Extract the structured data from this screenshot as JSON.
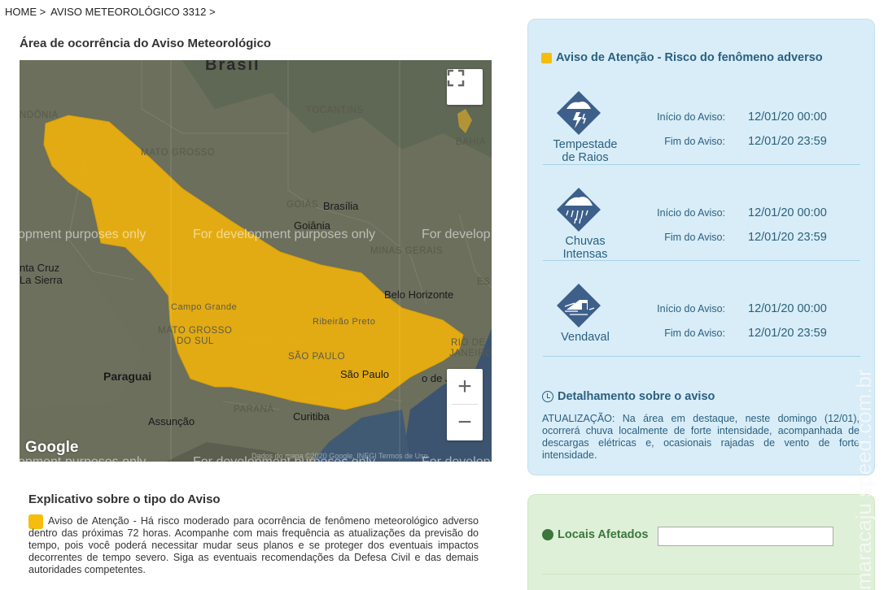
{
  "breadcrumb": {
    "home": "HOME >",
    "current": "AVISO METEOROLÓGICO 3312 >"
  },
  "map": {
    "title": "Área de ocorrência do Aviso Meteorológico",
    "country_label": "Brasil",
    "dev_watermark": "For development purposes only",
    "dev_watermark_left": "opment purposes only",
    "dev_watermark_right": "For develop",
    "labels": {
      "rondonia": "NDÔNIA",
      "tocantins": "TOCANTINS",
      "bahia": "BAHIA",
      "mato_grosso": "MATO GROSSO",
      "goias": "GOIÁS",
      "brasilia": "Brasília",
      "goiania": "Goiânia",
      "minas": "MINAS GERAIS",
      "es": "ES",
      "santa_cruz": "nta Cruz",
      "la_sierra": "La Sierra",
      "belo_horizonte": "Belo Horizonte",
      "campo_grande": "Campo Grande",
      "ms1": "MATO GROSSO",
      "ms2": "DO SUL",
      "ribeirao": "Ribeirão Preto",
      "rio1": "RIO DE",
      "rio2": "JANEIRO",
      "sao_paulo_state": "SÃO PAULO",
      "sao_paulo": "São Paulo",
      "rio_city": "o de Ja",
      "paraguai": "Paraguai",
      "parana": "PARANÁ",
      "curitiba": "Curitiba",
      "assuncao": "Assunção"
    },
    "google": "Google",
    "copyright": "Dados do mapa ©2020 Google, INEGI    Termos de Uso",
    "zoom_in": "+",
    "zoom_out": "−",
    "fullscreen_icon": "fullscreen-icon",
    "alert_color": "#f6bd0d"
  },
  "explicativo": {
    "title": "Explicativo sobre o tipo do Aviso",
    "text": "Aviso de Atenção - Há risco moderado para ocorrência de fenômeno meteorológico adverso dentro das próximas 72 horas. Acompanhe com mais frequência as atualizações da previsão do tempo, pois você poderá necessitar mudar seus planos e se proteger dos eventuais impactos decorrentes de tempo severo. Siga as eventuais recomendações da Defesa Civil e das demais autoridades competentes."
  },
  "aviso": {
    "title": "Aviso de Atenção - Risco do fenômeno adverso",
    "events": [
      {
        "name_line1": "Tempestade",
        "name_line2": "de Raios",
        "icon": "lightning-storm-icon",
        "inicio_label": "Início do Aviso:",
        "inicio": "12/01/20 00:00",
        "fim_label": "Fim do Aviso:",
        "fim": "12/01/20 23:59"
      },
      {
        "name_line1": "Chuvas",
        "name_line2": "Intensas",
        "icon": "heavy-rain-icon",
        "inicio_label": "Início do Aviso:",
        "inicio": "12/01/20 00:00",
        "fim_label": "Fim do Aviso:",
        "fim": "12/01/20 23:59"
      },
      {
        "name_line1": "Vendaval",
        "name_line2": "",
        "icon": "windstorm-icon",
        "inicio_label": "Início do Aviso:",
        "inicio": "12/01/20 00:00",
        "fim_label": "Fim do Aviso:",
        "fim": "12/01/20 23:59"
      }
    ],
    "detail_title": "Detalhamento sobre o aviso",
    "detail_text": "ATUALIZAÇÃO: Na área em destaque, neste domingo (12/01), ocorrerá chuva localmente de forte intensidade, acompanhada de descargas elétricas e, ocasionais rajadas de vento de forte intensidade."
  },
  "locais": {
    "title": "Locais Afetados",
    "input_value": ""
  },
  "watermark": "maracaju speed.com.br"
}
